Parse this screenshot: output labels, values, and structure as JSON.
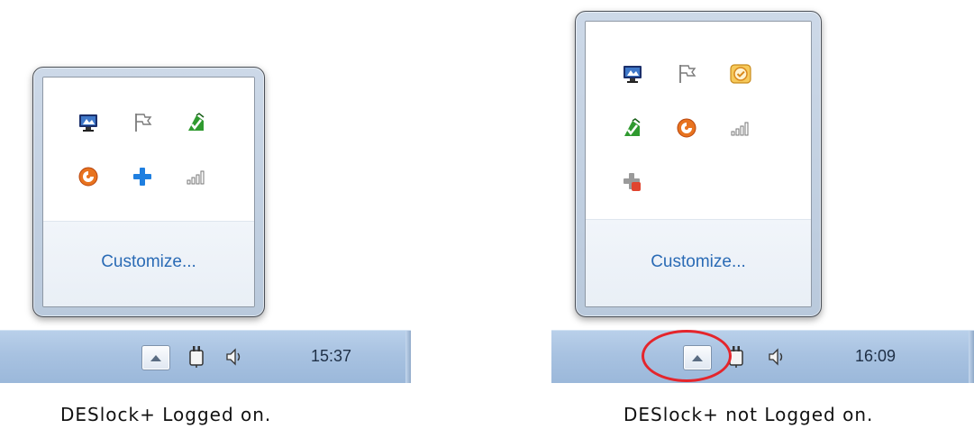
{
  "left_panel": {
    "customize_label": "Customize...",
    "icons": [
      "network-monitor-icon",
      "action-center-flag-icon",
      "green-check-app-icon",
      "orange-swirl-app-icon",
      "blue-plus-icon",
      "signal-bars-icon"
    ],
    "clock": "15:37",
    "caption": "DESlock+ Logged on."
  },
  "right_panel": {
    "customize_label": "Customize...",
    "icons": [
      "network-monitor-icon",
      "action-center-flag-icon",
      "orange-clock-app-icon",
      "green-check-app-icon",
      "orange-swirl-app-icon",
      "signal-bars-icon",
      "grey-plus-red-icon"
    ],
    "clock": "16:09",
    "caption": "DESlock+ not Logged on."
  },
  "colors": {
    "link_blue": "#2a6bb5",
    "highlight_red": "#e4252c",
    "taskbar_blue": "#a8c2e1"
  }
}
